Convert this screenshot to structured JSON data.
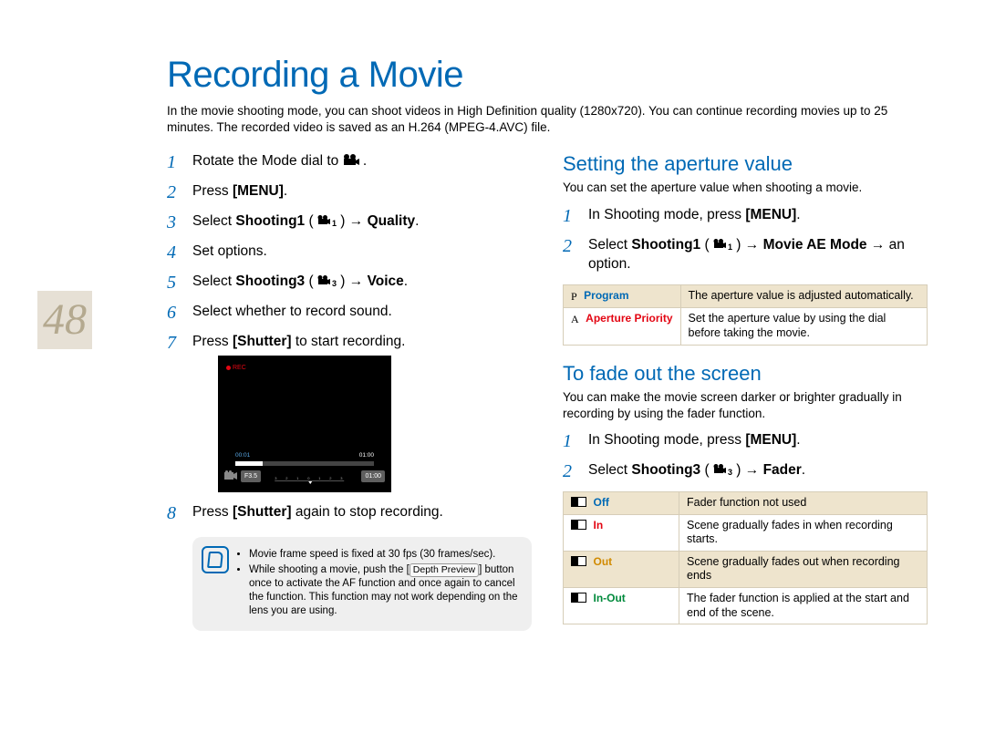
{
  "page_number": "48",
  "title": "Recording a Movie",
  "intro": "In the movie shooting mode, you can shoot videos in High Definition quality (1280x720). You can continue recording movies up to 25 minutes. The recorded video is saved as an H.264 (MPEG-4.AVC) file.",
  "left_steps": {
    "s1a": "Rotate the Mode dial to ",
    "s1b": ".",
    "s2a": "Press ",
    "s2b": "[MENU]",
    "s2c": ".",
    "s3a": "Select ",
    "s3b": "Shooting1",
    "s3c": " (",
    "s3d": ") → ",
    "s3e": "Quality",
    "s3f": ".",
    "s4": "Set options.",
    "s5a": "Select ",
    "s5b": "Shooting3",
    "s5c": " (",
    "s5d": ") → ",
    "s5e": "Voice",
    "s5f": ".",
    "s6": "Select whether to record sound.",
    "s7a": "Press ",
    "s7b": "[Shutter]",
    "s7c": " to start recording.",
    "s8a": "Press ",
    "s8b": "[Shutter]",
    "s8c": " again to stop recording."
  },
  "screenshot": {
    "rec": "REC",
    "pb_start": "00:01",
    "pb_end": "01:00",
    "f_chip": "F3.5",
    "time_chip": "01:00"
  },
  "tip": {
    "b1": "Movie frame speed is fixed at 30 fps (30 frames/sec).",
    "b2a": "While shooting a movie, push the [",
    "b2b": "Depth Preview",
    "b2c": "] button once to activate the AF function and once again to cancel the function. This function may not work depending on the lens you are using."
  },
  "aperture": {
    "heading": "Setting the aperture value",
    "desc": "You can set the aperture value when shooting a movie.",
    "s1a": "In Shooting mode, press ",
    "s1b": "[MENU]",
    "s1c": ".",
    "s2a": "Select ",
    "s2b": "Shooting1",
    "s2c": " (",
    "s2d": ") → ",
    "s2e": "Movie AE Mode",
    "s2f": " → an option.",
    "t_program": "Program",
    "t_program_desc": "The aperture value is adjusted automatically.",
    "t_apriority": "Aperture Priority",
    "t_apriority_desc": "Set the aperture value by using the dial before taking the movie."
  },
  "fader": {
    "heading": "To fade out the screen",
    "desc": "You can make the movie screen darker or brighter gradually in recording by using the fader function.",
    "s1a": "In Shooting mode, press ",
    "s1b": "[MENU]",
    "s1c": ".",
    "s2a": "Select ",
    "s2b": "Shooting3",
    "s2c": " (",
    "s2d": ") → ",
    "s2e": "Fader",
    "s2f": ".",
    "t_off": "Off",
    "t_off_desc": "Fader function not used",
    "t_in": "In",
    "t_in_desc": "Scene gradually fades in when recording starts.",
    "t_out": "Out",
    "t_out_desc": "Scene gradually fades out when recording ends",
    "t_inout": "In-Out",
    "t_inout_desc": "The fader function is applied at the start and end of the scene."
  },
  "chart_data": null
}
